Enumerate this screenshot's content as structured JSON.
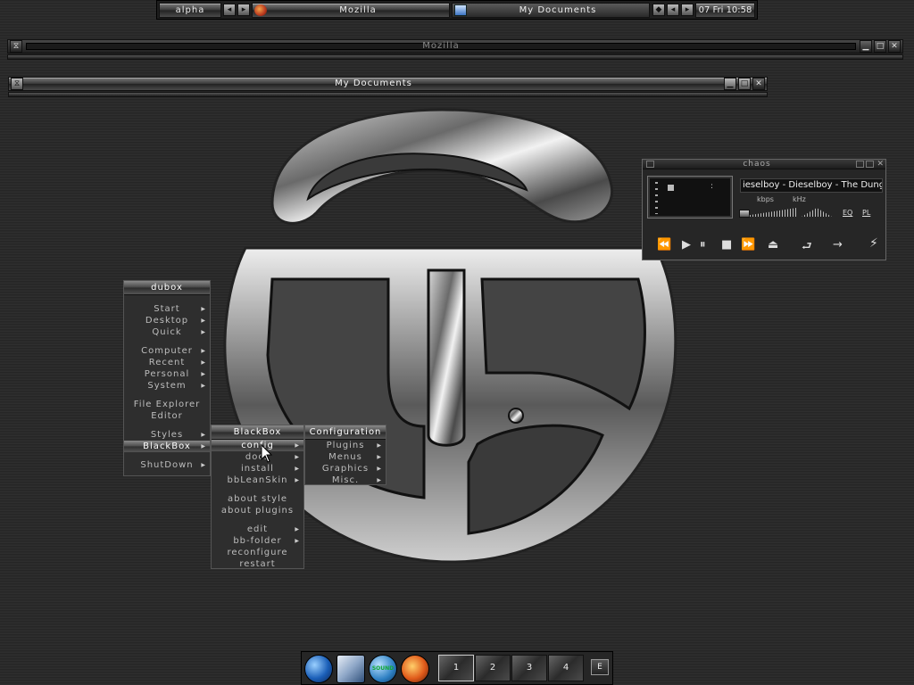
{
  "taskbar": {
    "workspace": "alpha",
    "tasks": [
      {
        "label": "Mozilla",
        "icon": "mozilla-icon"
      },
      {
        "label": "My Documents",
        "icon": "documents-icon"
      }
    ],
    "clock": "07 Fri 10:58"
  },
  "windows": {
    "mozilla": {
      "title": "Mozilla"
    },
    "documents": {
      "title": "My Documents"
    }
  },
  "menus": {
    "root": {
      "title": "dubox",
      "items": [
        "Start",
        "Desktop",
        "Quick",
        "Computer",
        "Recent",
        "Personal",
        "System",
        "File Explorer",
        "Editor",
        "Styles",
        "BlackBox",
        "ShutDown"
      ]
    },
    "blackbox": {
      "title": "BlackBox",
      "items": [
        "config",
        "docs",
        "install",
        "bbLeanSkin",
        "about style",
        "about plugins",
        "edit",
        "bb-folder",
        "reconfigure",
        "restart"
      ]
    },
    "configuration": {
      "title": "Configuration",
      "items": [
        "Plugins",
        "Menus",
        "Graphics",
        "Misc."
      ]
    }
  },
  "player": {
    "title": "chaos",
    "track": "ieselboy - Dieselboy - The Dung",
    "kbps_label": "kbps",
    "khz_label": "kHz",
    "eq_label": "EQ",
    "pl_label": "PL"
  },
  "dock": {
    "icons": [
      "globe-icon",
      "mail-icon",
      "sound-icon",
      "media-player-icon"
    ],
    "sound_label": "SOUND",
    "workspaces": [
      "1",
      "2",
      "3",
      "4"
    ],
    "current_workspace": "1",
    "end_label": "E"
  },
  "colors": {
    "background": "#2b2b2b",
    "chrome_light": "#8a8a8a",
    "chrome_dark": "#222222",
    "text": "#eeeeee"
  }
}
